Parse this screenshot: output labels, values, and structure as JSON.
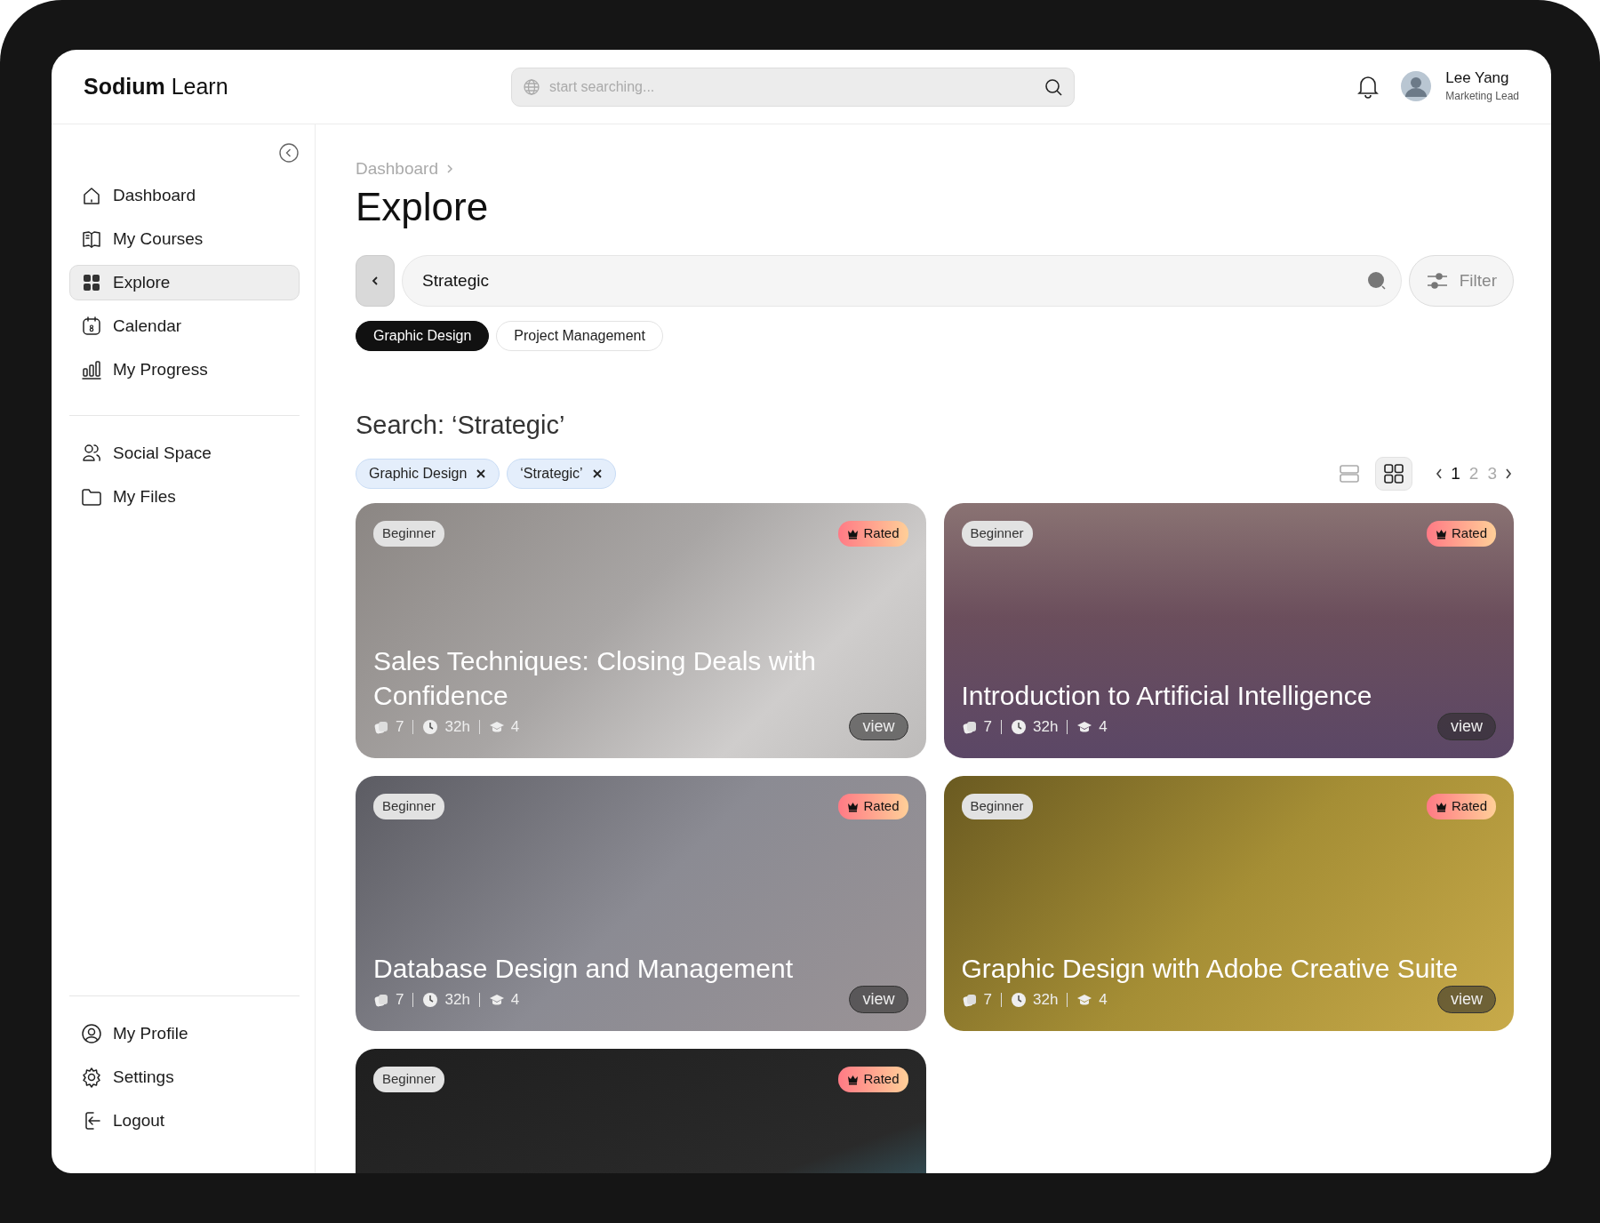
{
  "app": {
    "logo_bold": "Sodium",
    "logo_rest": "Learn"
  },
  "header": {
    "search": {
      "placeholder": "start searching..."
    },
    "user": {
      "name": "Lee Yang",
      "role": "Marketing Lead"
    }
  },
  "sidebar": {
    "main_items": [
      {
        "kind": "home",
        "label": "Dashboard",
        "selected": false
      },
      {
        "kind": "book",
        "label": "My Courses",
        "selected": false
      },
      {
        "kind": "grid",
        "label": "Explore",
        "selected": true
      },
      {
        "kind": "calendar",
        "label": "Calendar",
        "selected": false
      },
      {
        "kind": "chart",
        "label": "My Progress",
        "selected": false
      }
    ],
    "social_items": [
      {
        "kind": "people",
        "label": "Social Space",
        "selected": false
      },
      {
        "kind": "folder",
        "label": "My Files",
        "selected": false
      }
    ],
    "bottom_items": [
      {
        "kind": "profile",
        "label": "My Profile",
        "selected": false
      },
      {
        "kind": "gear",
        "label": "Settings",
        "selected": false
      },
      {
        "kind": "logout",
        "label": "Logout",
        "selected": false
      }
    ]
  },
  "breadcrumb": [
    "Dashboard"
  ],
  "title": "Explore",
  "search": {
    "value": "Strategic"
  },
  "filter_button": "Filter",
  "categories": [
    {
      "label": "Graphic Design",
      "selected": true
    },
    {
      "label": "Project Management",
      "selected": false
    }
  ],
  "results_heading": "Search: ‘Strategic’",
  "active_filters": [
    "Graphic Design",
    "‘Strategic’"
  ],
  "view_modes": [
    {
      "kind": "list",
      "selected": false
    },
    {
      "kind": "grid",
      "selected": true
    }
  ],
  "pages": [
    {
      "label": "1",
      "selected": true
    },
    {
      "label": "2",
      "selected": false
    },
    {
      "label": "3",
      "selected": false
    }
  ],
  "courses": [
    {
      "level": "Beginner",
      "badge": "Rated",
      "title": "Sales Techniques: Closing Deals with Confidence",
      "lessons": "7",
      "hours": "32h",
      "modules": "4",
      "action": "view"
    },
    {
      "level": "Beginner",
      "badge": "Rated",
      "title": "Introduction to Artificial Intelligence",
      "lessons": "7",
      "hours": "32h",
      "modules": "4",
      "action": "view"
    },
    {
      "level": "Beginner",
      "badge": "Rated",
      "title": "Database Design and Management",
      "lessons": "7",
      "hours": "32h",
      "modules": "4",
      "action": "view"
    },
    {
      "level": "Beginner",
      "badge": "Rated",
      "title": "Graphic Design with Adobe Creative Suite",
      "lessons": "7",
      "hours": "32h",
      "modules": "4",
      "action": "view"
    },
    {
      "level": "Beginner",
      "badge": "Rated"
    }
  ]
}
